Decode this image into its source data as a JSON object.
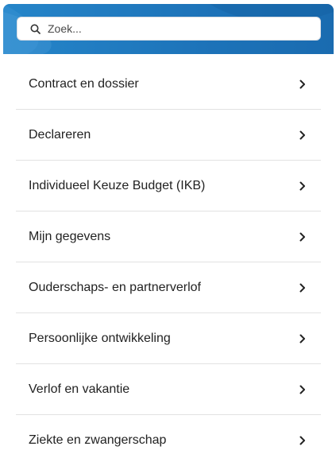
{
  "search": {
    "placeholder": "Zoek..."
  },
  "menu": {
    "items": [
      {
        "label": "Contract en dossier",
        "icon": "chevron-right-icon"
      },
      {
        "label": "Declareren",
        "icon": "chevron-right-icon"
      },
      {
        "label": "Individueel Keuze Budget (IKB)",
        "icon": "chevron-right-icon"
      },
      {
        "label": "Mijn gegevens",
        "icon": "chevron-right-icon"
      },
      {
        "label": "Ouderschaps- en partnerverlof",
        "icon": "chevron-right-icon"
      },
      {
        "label": "Persoonlijke ontwikkeling",
        "icon": "chevron-right-icon"
      },
      {
        "label": "Verlof en vakantie",
        "icon": "chevron-right-icon"
      },
      {
        "label": "Ziekte en zwangerschap",
        "icon": "chevron-right-icon"
      }
    ]
  },
  "colors": {
    "header": "#1d73b9",
    "text": "#222222",
    "divider": "#e2e2e2"
  }
}
